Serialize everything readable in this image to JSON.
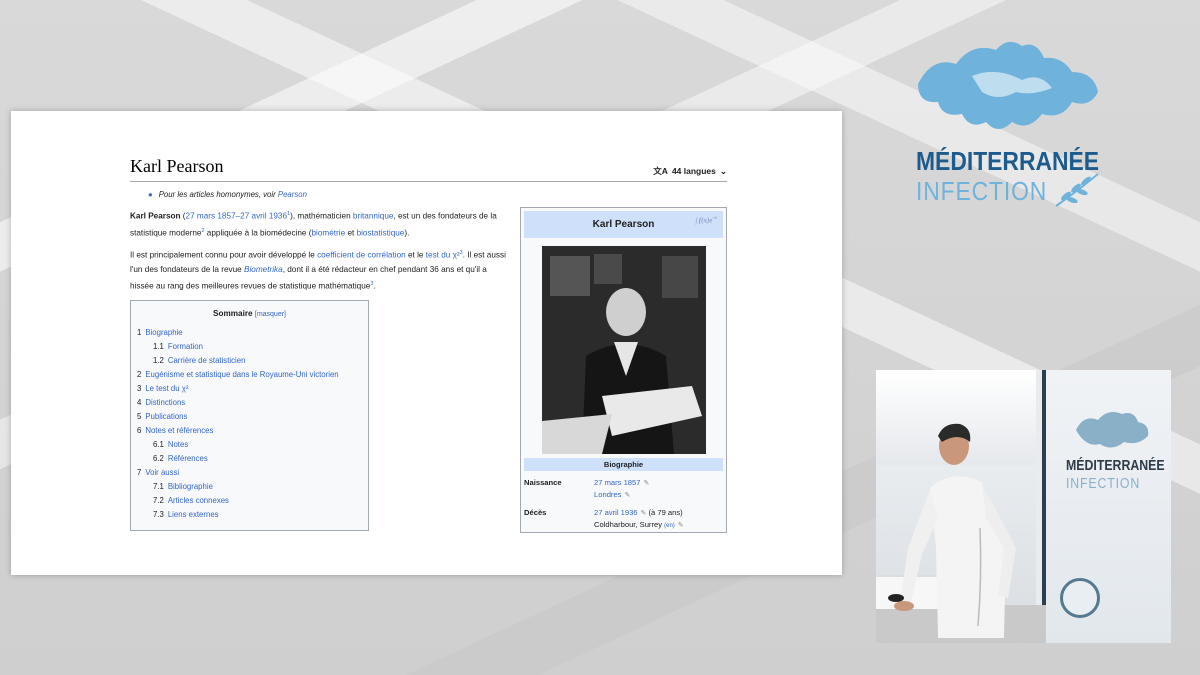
{
  "logo": {
    "line1": "MÉDITERRANÉE",
    "line2": "INFECTION"
  },
  "video_logo": {
    "line1": "MÉDITERRANÉE",
    "line2": "INFECTION"
  },
  "wiki": {
    "title": "Karl Pearson",
    "languages": "44 langues",
    "hatnote_prefix": "Pour les articles homonymes, voir",
    "hatnote_link": "Pearson",
    "p1": {
      "name": "Karl Pearson",
      "date_open": " (",
      "dates": "27 mars 1857–27 avril 1936",
      "sup1": "1",
      "text1": "), mathématicien",
      "link1": "britannique",
      "text2": ", est un des fondateurs de la statistique moderne",
      "sup2": "2",
      "text3": " appliquée à la biomédecine (",
      "link2": "biométrie",
      "text4": " et ",
      "link3": "biostatistique",
      "text5": ")."
    },
    "p2": {
      "text1": "Il est principalement connu pour avoir développé le",
      "link1": "coefficient de corrélation",
      "text2": " et le",
      "link2": "test du χ²",
      "sup1": "3",
      "text3": ". Il est aussi l'un des fondateurs de la revue",
      "journal": "Biometrika",
      "text4": ", dont il a été rédacteur en chef pendant 36 ans et qu'il a hissée au rang des meilleures revues de statistique mathématique",
      "sup2": "3",
      "text5": "."
    },
    "toc": {
      "title": "Sommaire",
      "hide": "[masquer]",
      "items": [
        {
          "n": "1",
          "label": "Biographie",
          "level": 1
        },
        {
          "n": "1.1",
          "label": "Formation",
          "level": 2
        },
        {
          "n": "1.2",
          "label": "Carrière de statisticien",
          "level": 2
        },
        {
          "n": "2",
          "label": "Eugénisme et statistique dans le Royaume-Uni victorien",
          "level": 1
        },
        {
          "n": "3",
          "label": "Le test du χ²",
          "level": 1
        },
        {
          "n": "4",
          "label": "Distinctions",
          "level": 1
        },
        {
          "n": "5",
          "label": "Publications",
          "level": 1
        },
        {
          "n": "6",
          "label": "Notes et références",
          "level": 1
        },
        {
          "n": "6.1",
          "label": "Notes",
          "level": 2
        },
        {
          "n": "6.2",
          "label": "Références",
          "level": 2
        },
        {
          "n": "7",
          "label": "Voir aussi",
          "level": 1
        },
        {
          "n": "7.1",
          "label": "Bibliographie",
          "level": 2
        },
        {
          "n": "7.2",
          "label": "Articles connexes",
          "level": 2
        },
        {
          "n": "7.3",
          "label": "Liens externes",
          "level": 2
        }
      ]
    },
    "infobox": {
      "title": "Karl Pearson",
      "section": "Biographie",
      "rows": [
        {
          "key": "Naissance",
          "v1": "27 mars 1857",
          "v2": "Londres"
        },
        {
          "key": "Décès",
          "v1": "27 avril 1936",
          "v1b": " (à 79 ans)",
          "v2": "Coldharbour, Surrey",
          "v2b": "(en)"
        }
      ]
    }
  },
  "colors": {
    "link": "#3366cc",
    "infobox_header": "#cfe0fa",
    "logo_dark": "#1c5b8c",
    "logo_light": "#6fb3dc"
  }
}
